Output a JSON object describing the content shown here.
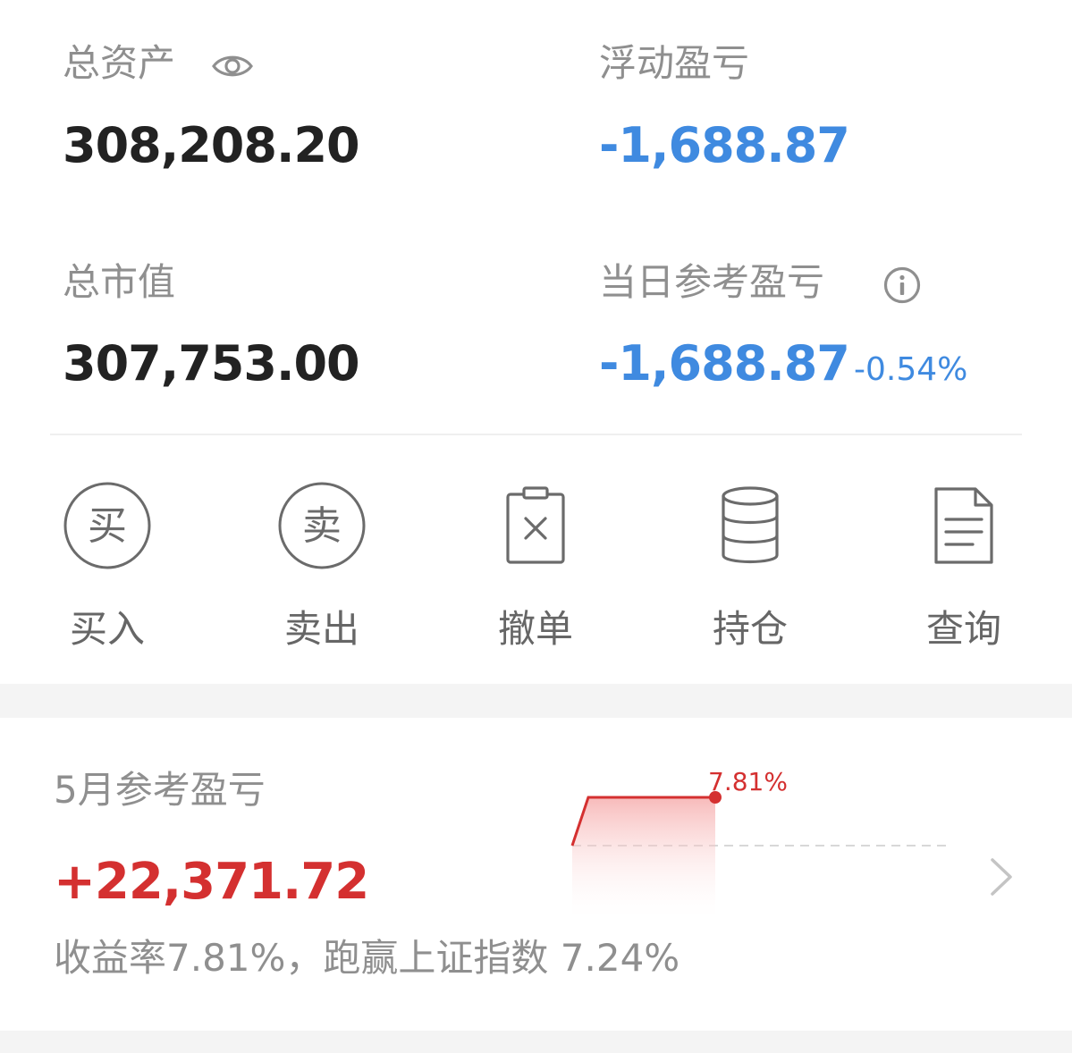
{
  "summary": {
    "total_assets_label": "总资产",
    "total_assets_value": "308,208.20",
    "floating_pl_label": "浮动盈亏",
    "floating_pl_value": "-1,688.87",
    "market_value_label": "总市值",
    "market_value_value": "307,753.00",
    "daily_pl_label": "当日参考盈亏",
    "daily_pl_value": "-1,688.87",
    "daily_pl_pct": "-0.54%"
  },
  "actions": [
    {
      "label": "买入",
      "icon_text": "买",
      "icon": "buy-icon"
    },
    {
      "label": "卖出",
      "icon_text": "卖",
      "icon": "sell-icon"
    },
    {
      "label": "撤单",
      "icon": "cancel-order-icon"
    },
    {
      "label": "持仓",
      "icon": "position-icon"
    },
    {
      "label": "查询",
      "icon": "query-icon"
    }
  ],
  "monthly": {
    "title": "5月参考盈亏",
    "value": "+22,371.72",
    "description": "收益率7.81%，跑赢上证指数 7.24%",
    "chart_label": "7.81%"
  },
  "colors": {
    "negative": "#3f8ae0",
    "positive": "#d43030",
    "label": "#8f8f8f",
    "value": "#222222",
    "section_gap": "#f4f4f4"
  },
  "chart_data": {
    "type": "area",
    "series": [
      {
        "values": [
          0,
          7.81,
          7.81
        ]
      }
    ],
    "annotations": [
      "7.81%"
    ],
    "baseline": 0,
    "grid": false
  }
}
